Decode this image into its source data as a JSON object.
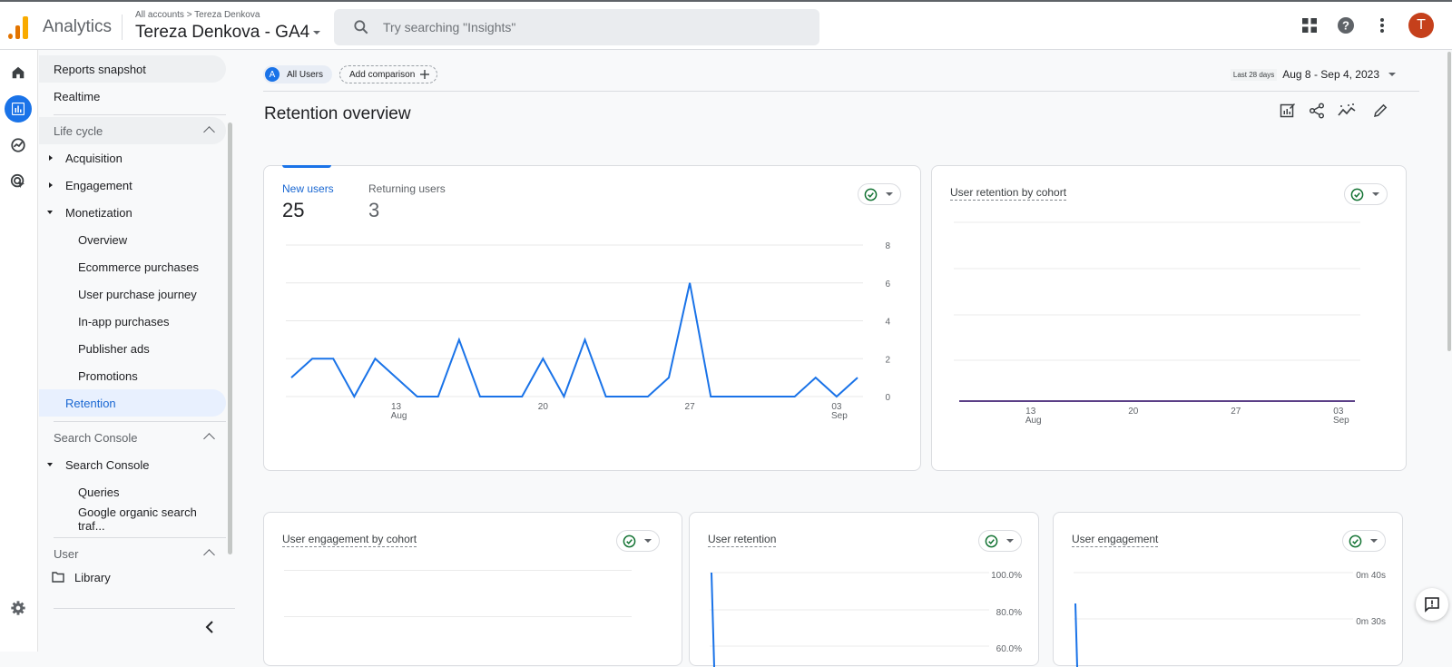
{
  "header": {
    "app_name": "Analytics",
    "breadcrumb": {
      "parent": "All accounts",
      "separator": ">",
      "current": "Tereza Denkova"
    },
    "property_name": "Tereza Denkova - GA4",
    "search": {
      "placeholder": "Try searching \"Insights\"",
      "value": ""
    },
    "icons": [
      "apps-grid-icon",
      "help-icon",
      "more-vert-icon"
    ],
    "avatar_letter": "T",
    "avatar_color": "#c5401b"
  },
  "rail": {
    "items": [
      "home-icon",
      "reports-icon",
      "explore-icon",
      "advertising-icon"
    ],
    "active": "reports-icon",
    "bottom": "settings-icon"
  },
  "sidebar": {
    "top_items": [
      {
        "label": "Reports snapshot"
      },
      {
        "label": "Realtime"
      }
    ],
    "sections": [
      {
        "label": "Life cycle",
        "expanded": true,
        "groups": [
          {
            "label": "Acquisition",
            "expanded": false
          },
          {
            "label": "Engagement",
            "expanded": false
          },
          {
            "label": "Monetization",
            "expanded": true,
            "children": [
              "Overview",
              "Ecommerce purchases",
              "User purchase journey",
              "In-app purchases",
              "Publisher ads",
              "Promotions"
            ]
          },
          {
            "label": "Retention",
            "selected": true
          }
        ]
      },
      {
        "label": "Search Console",
        "expanded": true,
        "groups": [
          {
            "label": "Search Console",
            "expanded": true,
            "children": [
              "Queries",
              "Google organic search traf..."
            ]
          }
        ]
      },
      {
        "label": "User",
        "expanded": true,
        "groups": [
          {
            "label": "Library",
            "icon": "folder-icon"
          }
        ]
      }
    ],
    "collapse_icon": "chevron-left-icon"
  },
  "toolbar": {
    "segment_chip": {
      "letter": "A",
      "label": "All Users"
    },
    "add_comparison": "Add comparison",
    "date_label": "Last 28 days",
    "date_range": "Aug 8 - Sep 4, 2023",
    "page_title": "Retention overview",
    "tools": [
      "customize-report-icon",
      "share-icon",
      "insights-icon",
      "edit-icon"
    ]
  },
  "accent_color": "#1a73e8",
  "cards": {
    "users": {
      "metrics": [
        {
          "label": "New users",
          "value": "25",
          "active": true
        },
        {
          "label": "Returning users",
          "value": "3",
          "active": false
        }
      ]
    },
    "cohort_retention": {
      "title": "User retention by cohort"
    },
    "engagement_cohort": {
      "title": "User engagement by cohort"
    },
    "user_retention": {
      "title": "User retention"
    },
    "user_engagement": {
      "title": "User engagement"
    }
  },
  "chart_data": [
    {
      "type": "line",
      "title": "New users",
      "x": [
        "Aug 8",
        "Aug 9",
        "Aug 10",
        "Aug 11",
        "Aug 12",
        "Aug 13",
        "Aug 14",
        "Aug 15",
        "Aug 16",
        "Aug 17",
        "Aug 18",
        "Aug 19",
        "Aug 20",
        "Aug 21",
        "Aug 22",
        "Aug 23",
        "Aug 24",
        "Aug 25",
        "Aug 26",
        "Aug 27",
        "Aug 28",
        "Aug 29",
        "Aug 30",
        "Aug 31",
        "Sep 1",
        "Sep 2",
        "Sep 3",
        "Sep 4"
      ],
      "series": [
        {
          "name": "New users",
          "values": [
            1,
            2,
            2,
            0,
            2,
            1,
            0,
            0,
            3,
            0,
            0,
            0,
            2,
            0,
            3,
            0,
            0,
            0,
            1,
            6,
            0,
            0,
            0,
            0,
            0,
            1,
            0,
            1
          ],
          "color": "#1a73e8"
        }
      ],
      "x_ticks": [
        {
          "label": "13",
          "sub": "Aug",
          "index": 5
        },
        {
          "label": "20",
          "sub": "",
          "index": 12
        },
        {
          "label": "27",
          "sub": "",
          "index": 19
        },
        {
          "label": "03",
          "sub": "Sep",
          "index": 26
        }
      ],
      "y_ticks": [
        "0",
        "2",
        "4",
        "6",
        "8"
      ],
      "ylim": [
        0,
        8
      ],
      "grid": true
    },
    {
      "type": "line",
      "title": "User retention by cohort",
      "x_ticks": [
        {
          "label": "13",
          "sub": "Aug",
          "index": 5
        },
        {
          "label": "20",
          "sub": "",
          "index": 12
        },
        {
          "label": "27",
          "sub": "",
          "index": 19
        },
        {
          "label": "03",
          "sub": "Sep",
          "index": 26
        }
      ],
      "series": [
        {
          "name": "cohort",
          "values": [
            0,
            0,
            0,
            0,
            0,
            0,
            0,
            0,
            0,
            0,
            0,
            0,
            0,
            0,
            0,
            0,
            0,
            0,
            0,
            0,
            0,
            0,
            0,
            0,
            0,
            0,
            0,
            0
          ],
          "color": "#5b3f87"
        }
      ],
      "grid": true
    },
    {
      "type": "line",
      "title": "User retention",
      "y_ticks": [
        "100.0%",
        "80.0%",
        "60.0%"
      ],
      "series": [
        {
          "name": "retention",
          "values": [
            100
          ],
          "color": "#1a73e8"
        }
      ]
    },
    {
      "type": "line",
      "title": "User engagement",
      "y_ticks": [
        "0m 40s",
        "0m 30s"
      ],
      "series": [
        {
          "name": "engagement",
          "values": [
            36
          ],
          "color": "#1a73e8"
        }
      ]
    }
  ]
}
